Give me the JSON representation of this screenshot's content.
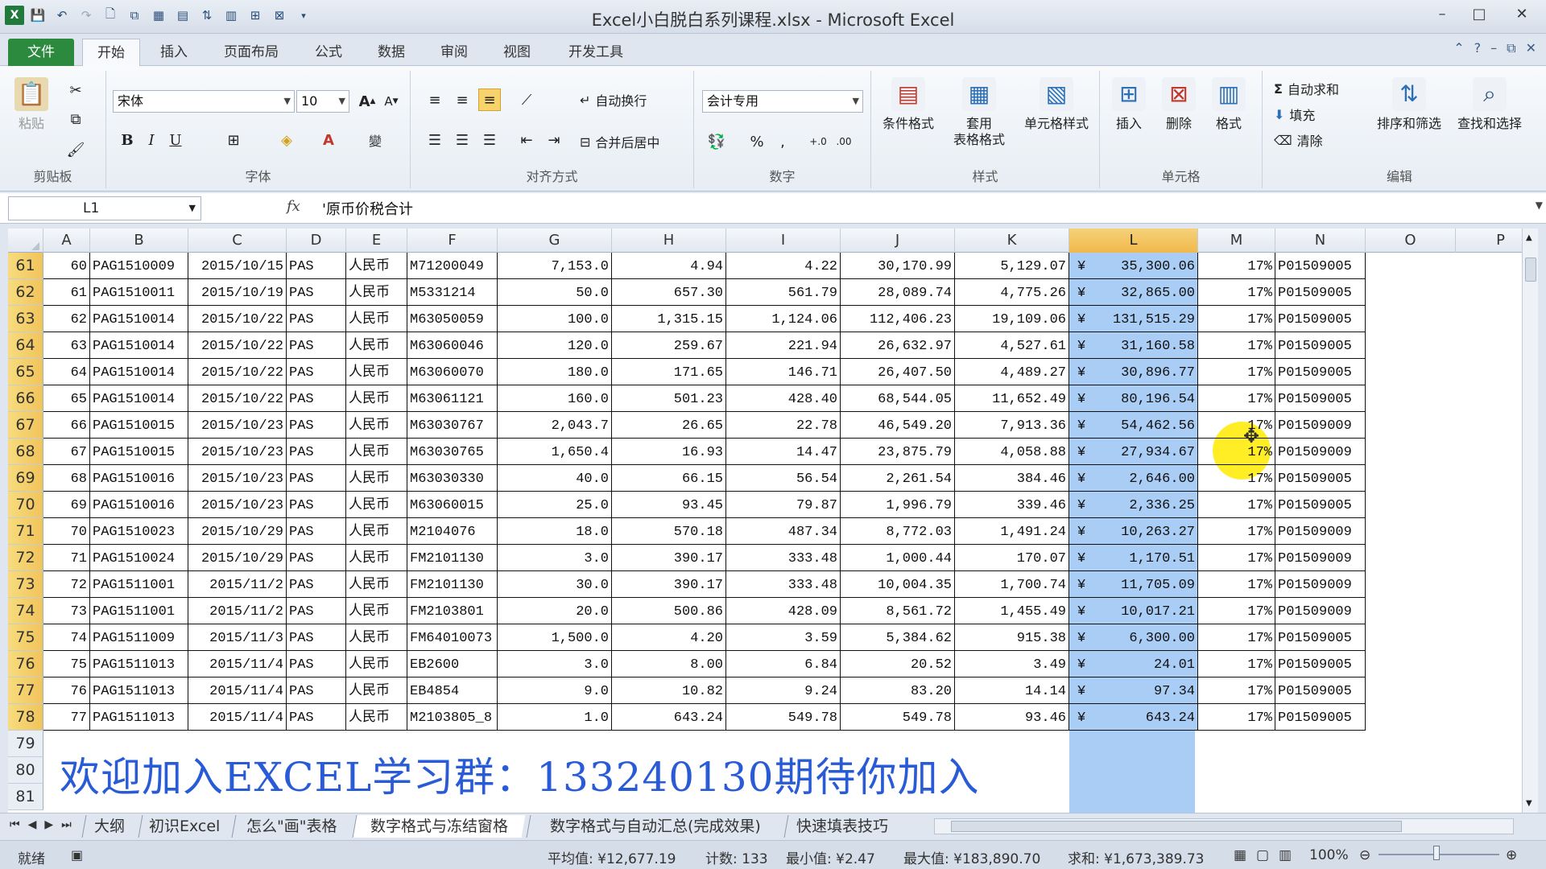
{
  "window": {
    "title": "Excel小白脱白系列课程.xlsx - Microsoft Excel"
  },
  "tabs": [
    "文件",
    "开始",
    "插入",
    "页面布局",
    "公式",
    "数据",
    "审阅",
    "视图",
    "开发工具"
  ],
  "ribbon": {
    "clipboard": {
      "paste": "粘贴",
      "label": "剪贴板"
    },
    "font": {
      "name": "宋体",
      "size": "10",
      "label": "字体"
    },
    "alignment": {
      "wrap": "自动换行",
      "merge": "合并后居中",
      "label": "对齐方式"
    },
    "number": {
      "format": "会计专用",
      "label": "数字"
    },
    "styles": {
      "conditional": "条件格式",
      "table1": "套用",
      "table2": "表格格式",
      "cell": "单元格样式",
      "label": "样式"
    },
    "cells": {
      "insert": "插入",
      "delete": "删除",
      "format": "格式",
      "label": "单元格"
    },
    "editing": {
      "autosum": "自动求和",
      "fill": "填充",
      "clear": "清除",
      "sort": "排序和筛选",
      "find": "查找和选择",
      "label": "编辑"
    }
  },
  "formula_bar": {
    "name_box": "L1",
    "fx": "fx",
    "content": "'原币价税合计"
  },
  "columns": [
    "A",
    "B",
    "C",
    "D",
    "E",
    "F",
    "G",
    "H",
    "I",
    "J",
    "K",
    "L",
    "M",
    "N",
    "O",
    "P"
  ],
  "rows": [
    {
      "n": "61",
      "a": "60",
      "b": "PAG1510009",
      "c": "2015/10/15",
      "d": "PAS",
      "e": "人民币",
      "f": "M71200049",
      "g": "7,153.0",
      "h": "4.94",
      "i": "4.22",
      "j": "30,170.99",
      "k": "5,129.07",
      "l": "35,300.06",
      "m": "17%",
      "nn": "P01509005"
    },
    {
      "n": "62",
      "a": "61",
      "b": "PAG1510011",
      "c": "2015/10/19",
      "d": "PAS",
      "e": "人民币",
      "f": "M5331214",
      "g": "50.0",
      "h": "657.30",
      "i": "561.79",
      "j": "28,089.74",
      "k": "4,775.26",
      "l": "32,865.00",
      "m": "17%",
      "nn": "P01509005"
    },
    {
      "n": "63",
      "a": "62",
      "b": "PAG1510014",
      "c": "2015/10/22",
      "d": "PAS",
      "e": "人民币",
      "f": "M63050059",
      "g": "100.0",
      "h": "1,315.15",
      "i": "1,124.06",
      "j": "112,406.23",
      "k": "19,109.06",
      "l": "131,515.29",
      "m": "17%",
      "nn": "P01509005"
    },
    {
      "n": "64",
      "a": "63",
      "b": "PAG1510014",
      "c": "2015/10/22",
      "d": "PAS",
      "e": "人民币",
      "f": "M63060046",
      "g": "120.0",
      "h": "259.67",
      "i": "221.94",
      "j": "26,632.97",
      "k": "4,527.61",
      "l": "31,160.58",
      "m": "17%",
      "nn": "P01509005"
    },
    {
      "n": "65",
      "a": "64",
      "b": "PAG1510014",
      "c": "2015/10/22",
      "d": "PAS",
      "e": "人民币",
      "f": "M63060070",
      "g": "180.0",
      "h": "171.65",
      "i": "146.71",
      "j": "26,407.50",
      "k": "4,489.27",
      "l": "30,896.77",
      "m": "17%",
      "nn": "P01509005"
    },
    {
      "n": "66",
      "a": "65",
      "b": "PAG1510014",
      "c": "2015/10/22",
      "d": "PAS",
      "e": "人民币",
      "f": "M63061121",
      "g": "160.0",
      "h": "501.23",
      "i": "428.40",
      "j": "68,544.05",
      "k": "11,652.49",
      "l": "80,196.54",
      "m": "17%",
      "nn": "P01509005"
    },
    {
      "n": "67",
      "a": "66",
      "b": "PAG1510015",
      "c": "2015/10/23",
      "d": "PAS",
      "e": "人民币",
      "f": "M63030767",
      "g": "2,043.7",
      "h": "26.65",
      "i": "22.78",
      "j": "46,549.20",
      "k": "7,913.36",
      "l": "54,462.56",
      "m": "17%",
      "nn": "P01509009"
    },
    {
      "n": "68",
      "a": "67",
      "b": "PAG1510015",
      "c": "2015/10/23",
      "d": "PAS",
      "e": "人民币",
      "f": "M63030765",
      "g": "1,650.4",
      "h": "16.93",
      "i": "14.47",
      "j": "23,875.79",
      "k": "4,058.88",
      "l": "27,934.67",
      "m": "17%",
      "nn": "P01509009"
    },
    {
      "n": "69",
      "a": "68",
      "b": "PAG1510016",
      "c": "2015/10/23",
      "d": "PAS",
      "e": "人民币",
      "f": "M63030330",
      "g": "40.0",
      "h": "66.15",
      "i": "56.54",
      "j": "2,261.54",
      "k": "384.46",
      "l": "2,646.00",
      "m": "17%",
      "nn": "P01509005"
    },
    {
      "n": "70",
      "a": "69",
      "b": "PAG1510016",
      "c": "2015/10/23",
      "d": "PAS",
      "e": "人民币",
      "f": "M63060015",
      "g": "25.0",
      "h": "93.45",
      "i": "79.87",
      "j": "1,996.79",
      "k": "339.46",
      "l": "2,336.25",
      "m": "17%",
      "nn": "P01509005"
    },
    {
      "n": "71",
      "a": "70",
      "b": "PAG1510023",
      "c": "2015/10/29",
      "d": "PAS",
      "e": "人民币",
      "f": "M2104076",
      "g": "18.0",
      "h": "570.18",
      "i": "487.34",
      "j": "8,772.03",
      "k": "1,491.24",
      "l": "10,263.27",
      "m": "17%",
      "nn": "P01509009"
    },
    {
      "n": "72",
      "a": "71",
      "b": "PAG1510024",
      "c": "2015/10/29",
      "d": "PAS",
      "e": "人民币",
      "f": "FM2101130",
      "g": "3.0",
      "h": "390.17",
      "i": "333.48",
      "j": "1,000.44",
      "k": "170.07",
      "l": "1,170.51",
      "m": "17%",
      "nn": "P01509009"
    },
    {
      "n": "73",
      "a": "72",
      "b": "PAG1511001",
      "c": "2015/11/2",
      "d": "PAS",
      "e": "人民币",
      "f": "FM2101130",
      "g": "30.0",
      "h": "390.17",
      "i": "333.48",
      "j": "10,004.35",
      "k": "1,700.74",
      "l": "11,705.09",
      "m": "17%",
      "nn": "P01509009"
    },
    {
      "n": "74",
      "a": "73",
      "b": "PAG1511001",
      "c": "2015/11/2",
      "d": "PAS",
      "e": "人民币",
      "f": "FM2103801",
      "g": "20.0",
      "h": "500.86",
      "i": "428.09",
      "j": "8,561.72",
      "k": "1,455.49",
      "l": "10,017.21",
      "m": "17%",
      "nn": "P01509009"
    },
    {
      "n": "75",
      "a": "74",
      "b": "PAG1511009",
      "c": "2015/11/3",
      "d": "PAS",
      "e": "人民币",
      "f": "FM64010073",
      "g": "1,500.0",
      "h": "4.20",
      "i": "3.59",
      "j": "5,384.62",
      "k": "915.38",
      "l": "6,300.00",
      "m": "17%",
      "nn": "P01509005"
    },
    {
      "n": "76",
      "a": "75",
      "b": "PAG1511013",
      "c": "2015/11/4",
      "d": "PAS",
      "e": "人民币",
      "f": "EB2600",
      "g": "3.0",
      "h": "8.00",
      "i": "6.84",
      "j": "20.52",
      "k": "3.49",
      "l": "24.01",
      "m": "17%",
      "nn": "P01509005"
    },
    {
      "n": "77",
      "a": "76",
      "b": "PAG1511013",
      "c": "2015/11/4",
      "d": "PAS",
      "e": "人民币",
      "f": "EB4854",
      "g": "9.0",
      "h": "10.82",
      "i": "9.24",
      "j": "83.20",
      "k": "14.14",
      "l": "97.34",
      "m": "17%",
      "nn": "P01509005"
    },
    {
      "n": "78",
      "a": "77",
      "b": "PAG1511013",
      "c": "2015/11/4",
      "d": "PAS",
      "e": "人民币",
      "f": "M2103805_8",
      "g": "1.0",
      "h": "643.24",
      "i": "549.78",
      "j": "549.78",
      "k": "93.46",
      "l": "643.24",
      "m": "17%",
      "nn": "P01509005"
    }
  ],
  "empty_rows": [
    "79",
    "80",
    "81"
  ],
  "currency_symbol": "¥",
  "banner": "欢迎加入EXCEL学习群：133240130期待你加入",
  "sheet_tabs": [
    "大纲",
    "初识Excel",
    "怎么\"画\"表格",
    "数字格式与冻结窗格",
    "数字格式与自动汇总(完成效果)",
    "快速填表技巧"
  ],
  "status": {
    "ready": "就绪",
    "average": "平均值: ¥12,677.19",
    "count": "计数: 133",
    "min": "最小值: ¥2.47",
    "max": "最大值: ¥183,890.70",
    "sum": "求和: ¥1,673,389.73",
    "zoom": "100%"
  },
  "colors": {
    "accent_green": "#2b8a3e",
    "selection_blue": "#a9cdf5",
    "header_highlight": "#f1c35a",
    "banner_blue": "#2a5bd7"
  }
}
